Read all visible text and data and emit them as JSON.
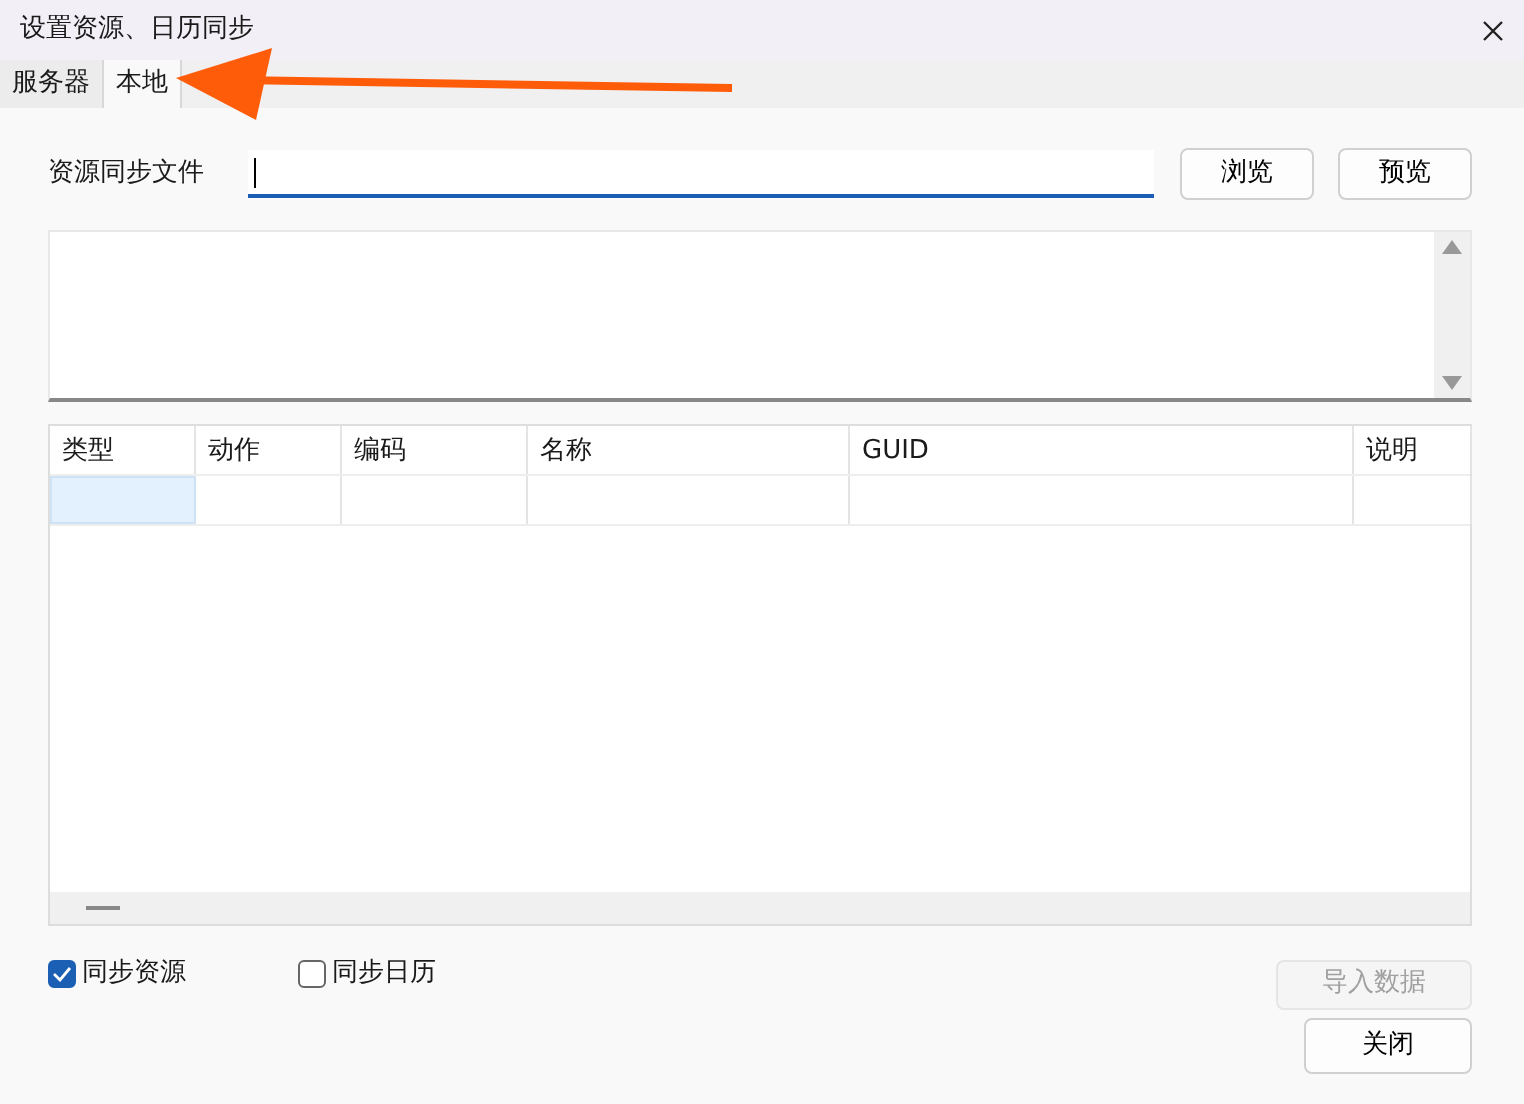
{
  "window": {
    "title": "设置资源、日历同步"
  },
  "tabs": [
    {
      "label": "服务器",
      "selected": false
    },
    {
      "label": "本地",
      "selected": true
    }
  ],
  "file": {
    "label": "资源同步文件",
    "focused": true
  },
  "file_buttons": [
    "浏览",
    "预览"
  ],
  "table": {
    "columns": [
      "类型",
      "动作",
      "编码",
      "名称",
      "GUID",
      "说明"
    ],
    "rows": [
      {
        "cells_selected": [
          true,
          false,
          false,
          false,
          false,
          false
        ]
      }
    ]
  },
  "options": [
    {
      "label": "同步资源",
      "checked": true
    },
    {
      "label": "同步日历",
      "checked": false
    }
  ],
  "import_button": {
    "label": "导入数据",
    "disabled": true
  },
  "close_button": {
    "label": "关闭"
  },
  "annotations": [
    {
      "kind": "arrow"
    }
  ]
}
